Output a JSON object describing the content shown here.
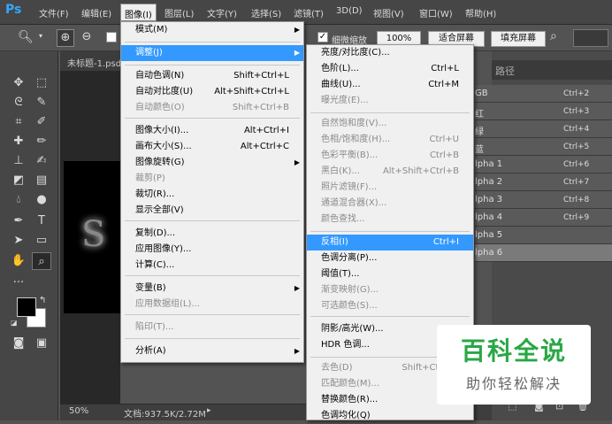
{
  "menubar": {
    "logo": "Ps",
    "items": [
      {
        "label": "文件(F)"
      },
      {
        "label": "编辑(E)"
      },
      {
        "label": "图像(I)"
      },
      {
        "label": "图层(L)"
      },
      {
        "label": "文字(Y)"
      },
      {
        "label": "选择(S)"
      },
      {
        "label": "滤镜(T)"
      },
      {
        "label": "3D(D)"
      },
      {
        "label": "视图(V)"
      },
      {
        "label": "窗口(W)"
      },
      {
        "label": "帮助(H)"
      }
    ]
  },
  "options_bar": {
    "fine_zoom_label": "细微缩放",
    "zoom_value": "100%",
    "fit_screen": "适合屏幕",
    "fill_screen": "填充屏幕"
  },
  "document": {
    "tab_title": "未标题-1.psd",
    "zoom": "50%",
    "doc_info": "文档:937.5K/2.72M"
  },
  "panel": {
    "tab_paths": "路径",
    "channels": [
      {
        "name": "GB",
        "key": "Ctrl+2"
      },
      {
        "name": "红",
        "key": "Ctrl+3"
      },
      {
        "name": "绿",
        "key": "Ctrl+4"
      },
      {
        "name": "蓝",
        "key": "Ctrl+5"
      },
      {
        "name": "lpha 1",
        "key": "Ctrl+6"
      },
      {
        "name": "lpha 2",
        "key": "Ctrl+7"
      },
      {
        "name": "lpha 3",
        "key": "Ctrl+8"
      },
      {
        "name": "lpha 4",
        "key": "Ctrl+9"
      },
      {
        "name": "lpha 5",
        "key": ""
      },
      {
        "name": "lpha 6",
        "key": ""
      }
    ]
  },
  "image_menu": {
    "items": [
      {
        "label": "模式(M)",
        "key": "",
        "submenu": true,
        "disabled": false
      },
      {
        "label": "调整(J)",
        "key": "",
        "submenu": true,
        "disabled": false
      },
      {
        "label": "自动色调(N)",
        "key": "Shift+Ctrl+L",
        "disabled": false
      },
      {
        "label": "自动对比度(U)",
        "key": "Alt+Shift+Ctrl+L",
        "disabled": false
      },
      {
        "label": "自动颜色(O)",
        "key": "Shift+Ctrl+B",
        "disabled": true
      },
      {
        "label": "图像大小(I)...",
        "key": "Alt+Ctrl+I",
        "disabled": false
      },
      {
        "label": "画布大小(S)...",
        "key": "Alt+Ctrl+C",
        "disabled": false
      },
      {
        "label": "图像旋转(G)",
        "key": "",
        "submenu": true,
        "disabled": false
      },
      {
        "label": "裁剪(P)",
        "key": "",
        "disabled": true
      },
      {
        "label": "裁切(R)...",
        "key": "",
        "disabled": false
      },
      {
        "label": "显示全部(V)",
        "key": "",
        "disabled": false
      },
      {
        "label": "复制(D)...",
        "key": "",
        "disabled": false
      },
      {
        "label": "应用图像(Y)...",
        "key": "",
        "disabled": false
      },
      {
        "label": "计算(C)...",
        "key": "",
        "disabled": false
      },
      {
        "label": "变量(B)",
        "key": "",
        "submenu": true,
        "disabled": false
      },
      {
        "label": "应用数据组(L)...",
        "key": "",
        "disabled": true
      },
      {
        "label": "陷印(T)...",
        "key": "",
        "disabled": true
      },
      {
        "label": "分析(A)",
        "key": "",
        "submenu": true,
        "disabled": false
      }
    ]
  },
  "adjust_menu": {
    "items": [
      {
        "label": "亮度/对比度(C)...",
        "key": "",
        "disabled": false
      },
      {
        "label": "色阶(L)...",
        "key": "Ctrl+L",
        "disabled": false
      },
      {
        "label": "曲线(U)...",
        "key": "Ctrl+M",
        "disabled": false
      },
      {
        "label": "曝光度(E)...",
        "key": "",
        "disabled": true
      },
      {
        "label": "自然饱和度(V)...",
        "key": "",
        "disabled": true
      },
      {
        "label": "色相/饱和度(H)...",
        "key": "Ctrl+U",
        "disabled": true
      },
      {
        "label": "色彩平衡(B)...",
        "key": "Ctrl+B",
        "disabled": true
      },
      {
        "label": "黑白(K)...",
        "key": "Alt+Shift+Ctrl+B",
        "disabled": true
      },
      {
        "label": "照片滤镜(F)...",
        "key": "",
        "disabled": true
      },
      {
        "label": "通道混合器(X)...",
        "key": "",
        "disabled": true
      },
      {
        "label": "颜色查找...",
        "key": "",
        "disabled": true
      },
      {
        "label": "反相(I)",
        "key": "Ctrl+I",
        "disabled": false
      },
      {
        "label": "色调分离(P)...",
        "key": "",
        "disabled": false
      },
      {
        "label": "阈值(T)...",
        "key": "",
        "disabled": false
      },
      {
        "label": "渐变映射(G)...",
        "key": "",
        "disabled": true
      },
      {
        "label": "可选颜色(S)...",
        "key": "",
        "disabled": true
      },
      {
        "label": "阴影/高光(W)...",
        "key": "",
        "disabled": false
      },
      {
        "label": "HDR 色调...",
        "key": "",
        "disabled": false
      },
      {
        "label": "去色(D)",
        "key": "Shift+Ctrl+U",
        "disabled": true
      },
      {
        "label": "匹配颜色(M)...",
        "key": "",
        "disabled": true
      },
      {
        "label": "替换颜色(R)...",
        "key": "",
        "disabled": false
      },
      {
        "label": "色调均化(Q)",
        "key": "",
        "disabled": false
      }
    ]
  },
  "watermark": {
    "title": "百科全说",
    "subtitle": "助你轻松解决"
  }
}
